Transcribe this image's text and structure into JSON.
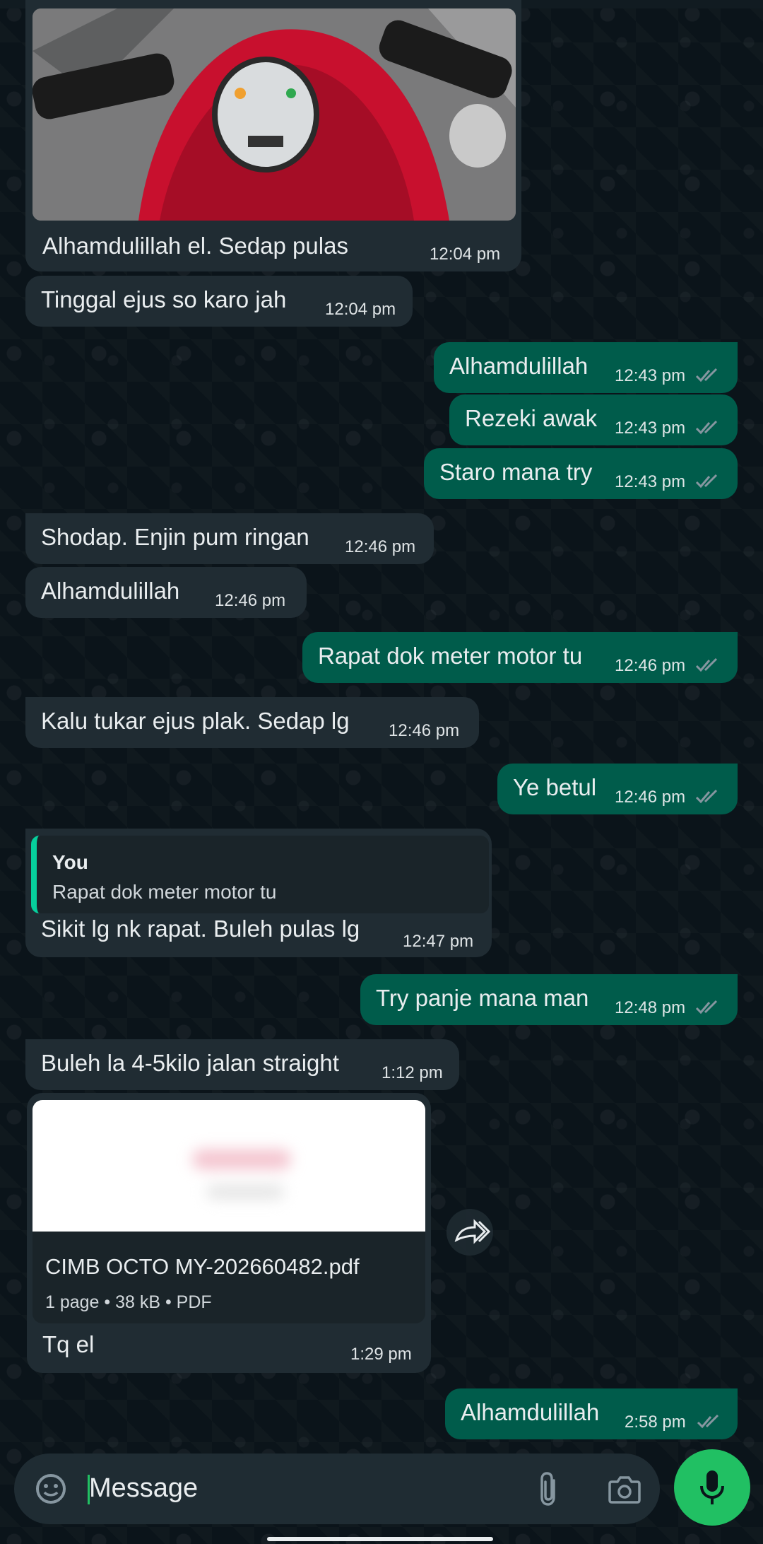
{
  "colors": {
    "incoming_bubble": "#202c33",
    "outgoing_bubble": "#005c4b",
    "accent_green": "#21c063",
    "quote_bar": "#06cf9c"
  },
  "messages": [
    {
      "type": "image",
      "direction": "in",
      "caption": "Alhamdulillah el. Sedap pulas",
      "time": "12:04 pm",
      "image_desc_icon": "photo-icon"
    },
    {
      "type": "text",
      "direction": "in",
      "text": "Tinggal ejus so karo jah",
      "time": "12:04 pm"
    },
    {
      "type": "text",
      "direction": "out",
      "text": "Alhamdulillah",
      "time": "12:43 pm",
      "status": "read"
    },
    {
      "type": "text",
      "direction": "out",
      "text": "Rezeki awak",
      "time": "12:43 pm",
      "status": "read"
    },
    {
      "type": "text",
      "direction": "out",
      "text": "Staro mana try",
      "time": "12:43 pm",
      "status": "read"
    },
    {
      "type": "text",
      "direction": "in",
      "text": "Shodap. Enjin pum ringan",
      "time": "12:46 pm"
    },
    {
      "type": "text",
      "direction": "in",
      "text": "Alhamdulillah",
      "time": "12:46 pm"
    },
    {
      "type": "text",
      "direction": "out",
      "text": "Rapat dok meter motor tu",
      "time": "12:46 pm",
      "status": "read"
    },
    {
      "type": "text",
      "direction": "in",
      "text": "Kalu tukar ejus plak. Sedap lg",
      "time": "12:46 pm"
    },
    {
      "type": "text",
      "direction": "out",
      "text": "Ye betul",
      "time": "12:46 pm",
      "status": "read"
    },
    {
      "type": "reply",
      "direction": "in",
      "quote_author": "You",
      "quote_text": "Rapat dok meter motor tu",
      "text": "Sikit lg nk rapat. Buleh pulas lg",
      "time": "12:47 pm"
    },
    {
      "type": "text",
      "direction": "out",
      "text": "Try panje mana man",
      "time": "12:48 pm",
      "status": "read"
    },
    {
      "type": "text",
      "direction": "in",
      "text": "Buleh la 4-5kilo jalan straight",
      "time": "1:12 pm"
    },
    {
      "type": "document",
      "direction": "in",
      "file_name": "CIMB OCTO MY-202660482.pdf",
      "file_meta": "1 page • 38 kB • PDF",
      "caption": "Tq el",
      "time": "1:29 pm"
    },
    {
      "type": "text",
      "direction": "out",
      "text": "Alhamdulillah",
      "time": "2:58 pm",
      "status": "read"
    }
  ],
  "composer": {
    "placeholder": "Message",
    "emoji_icon": "sticker-icon",
    "attach_icon": "paperclip-icon",
    "camera_icon": "camera-icon",
    "mic_icon": "mic-icon"
  },
  "forward_icon": "forward-icon"
}
